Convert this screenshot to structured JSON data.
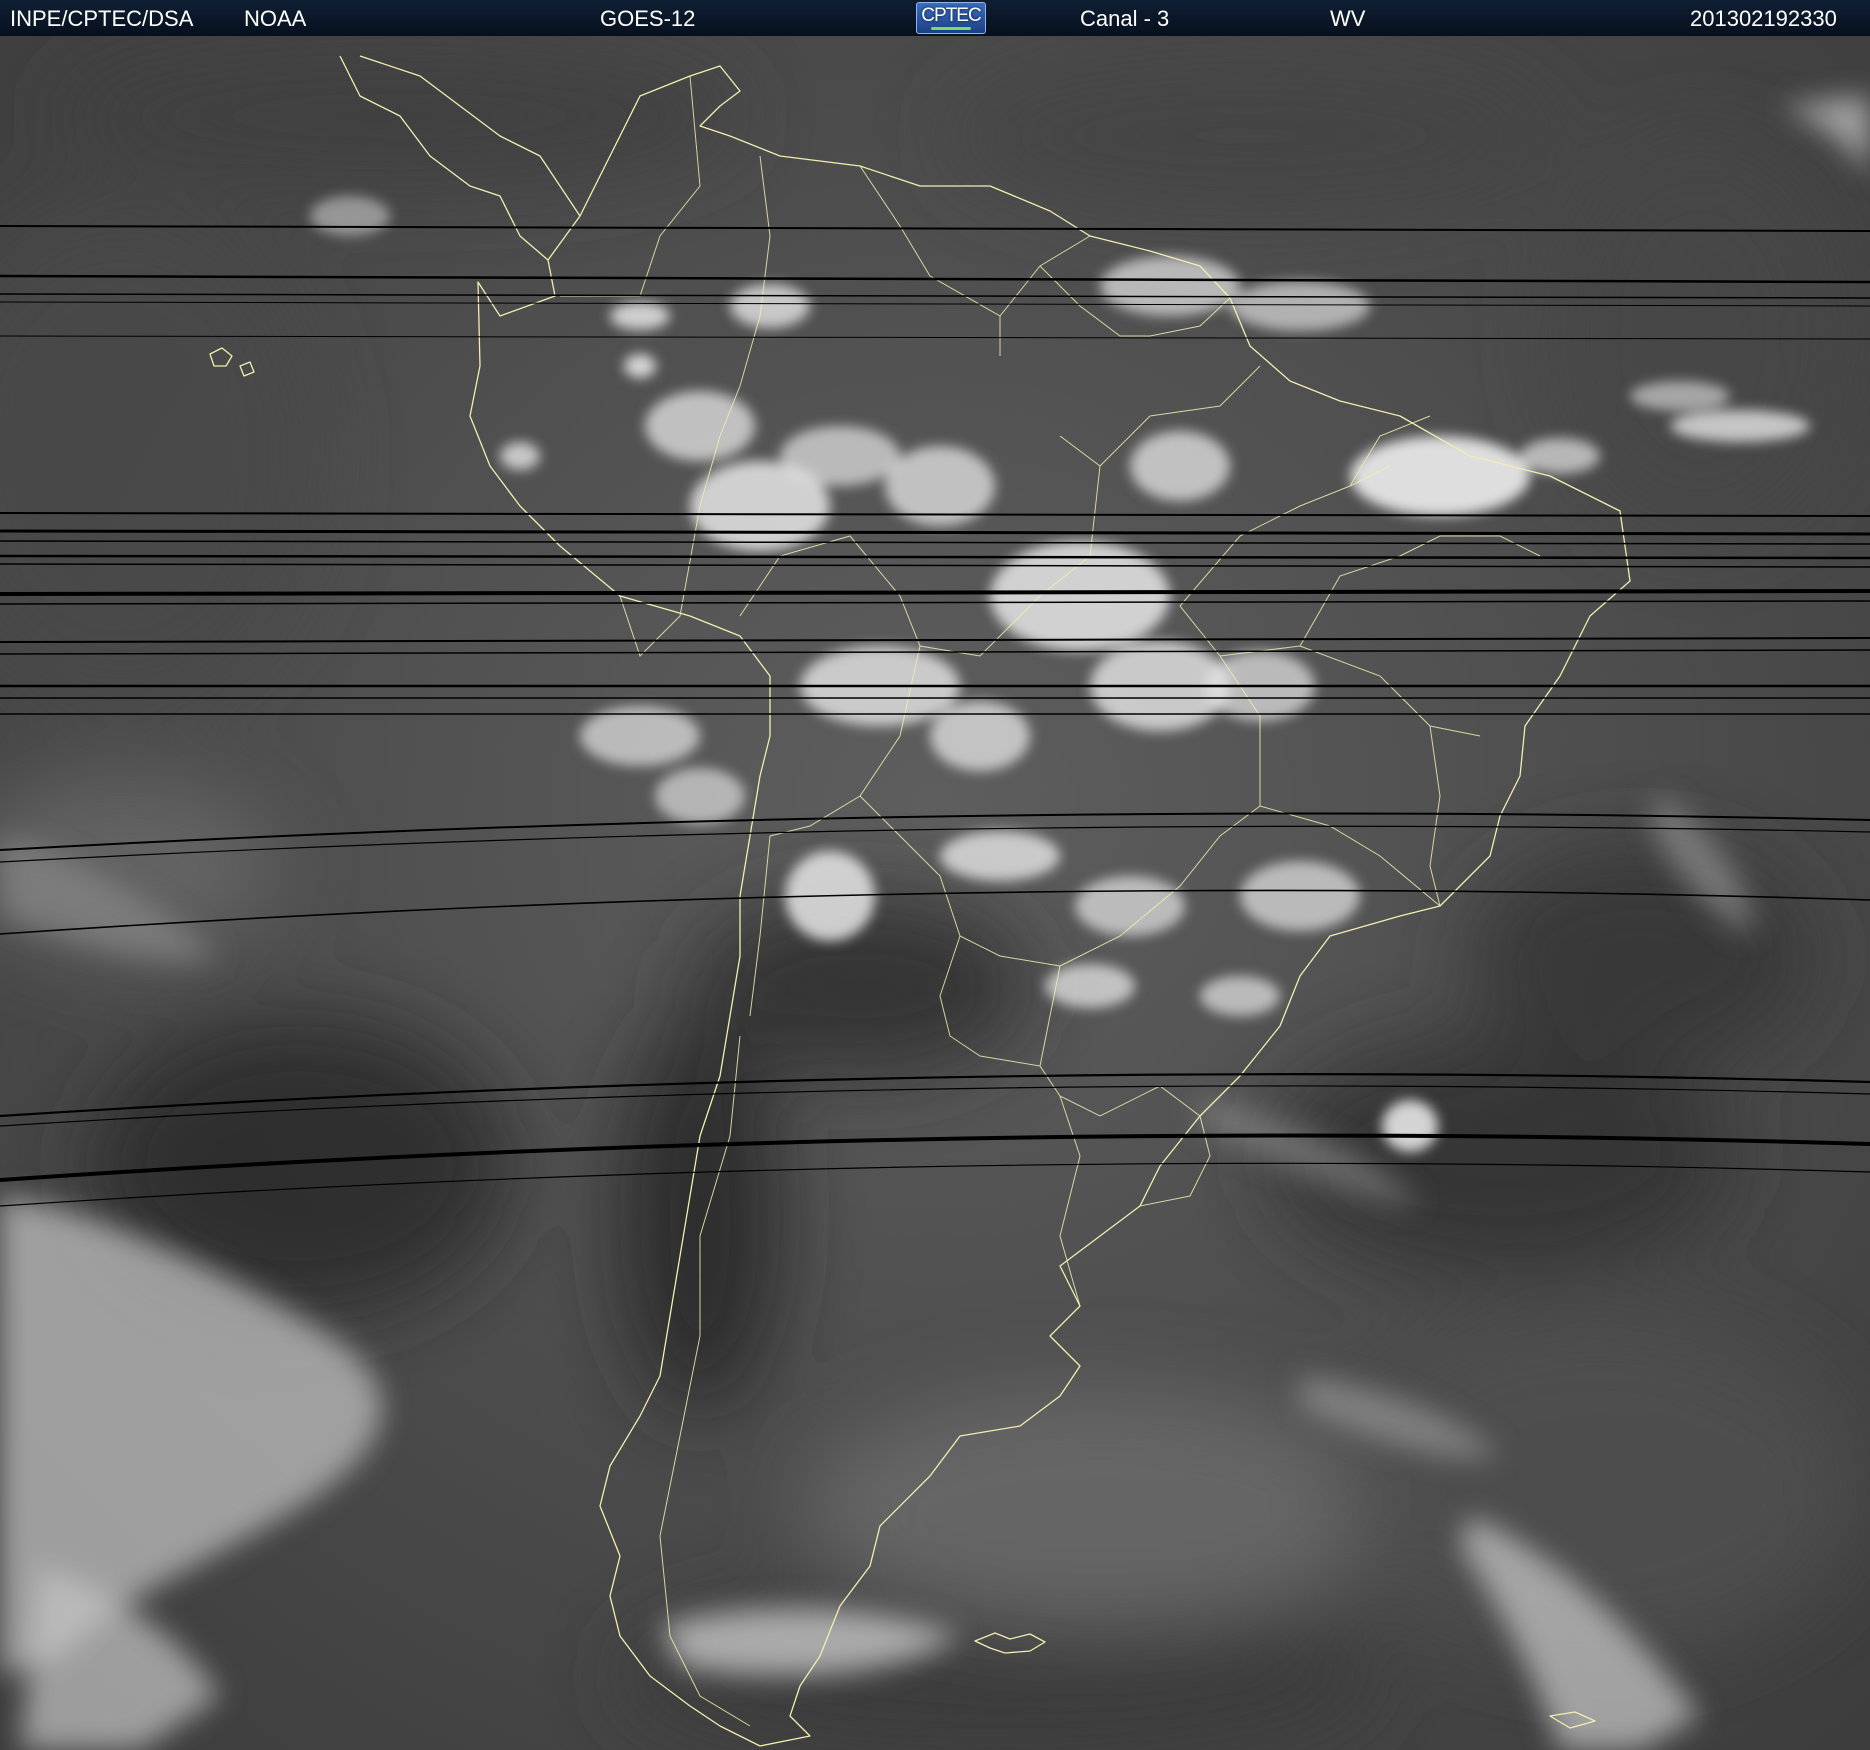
{
  "header": {
    "institution": "INPE/CPTEC/DSA",
    "agency": "NOAA",
    "satellite": "GOES-12",
    "logo_text": "CPTEC",
    "channel": "Canal - 3",
    "band": "WV",
    "timestamp": "201302192330"
  },
  "colors": {
    "header_bg": "#0b1a2e",
    "header_text": "#ffffff",
    "coastline": "#f1eeb0",
    "logo_blue": "#2a56a8",
    "logo_green": "#7cd86a"
  },
  "map": {
    "projection": "geostationary satellite image",
    "region": "South America",
    "imagery": "water vapor (grayscale)",
    "overlays": [
      "coastlines",
      "country borders",
      "state borders"
    ],
    "artifacts": "horizontal black scan-line dropouts"
  }
}
